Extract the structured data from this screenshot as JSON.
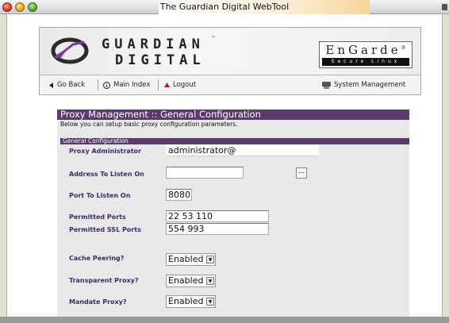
{
  "window": {
    "title": "The Guardian Digital WebTool"
  },
  "logo": {
    "word_top": "GUARDIAN",
    "word_bottom": "DIGITAL",
    "tm": "™",
    "engarde_name": "EnGarde",
    "engarde_tm": "®",
    "engarde_sub": "Secure Linux"
  },
  "nav": {
    "back": "Go Back",
    "main_index": "Main Index",
    "logout": "Logout",
    "system_management": "System Management",
    "icons": {
      "back": "triangle-left-icon",
      "main_index": "info-circle-icon",
      "logout": "triangle-up-icon",
      "system_management": "server-icon"
    }
  },
  "page": {
    "title": "Proxy Management :: General Configuration",
    "description": "Below you can setup basic proxy configuration parameters.",
    "subheader": "General Configuration"
  },
  "form": {
    "proxy_admin": {
      "label": "Proxy Administrator",
      "value": "administrator@"
    },
    "address": {
      "label": "Address To Listen On",
      "value": "",
      "browse": "..."
    },
    "port": {
      "label": "Port To Listen On",
      "value": "8080"
    },
    "permitted_ports": {
      "label": "Permitted Ports",
      "value": "22 53 110"
    },
    "permitted_ssl_ports": {
      "label": "Permitted SSL Ports",
      "value": "554 993"
    },
    "cache_peering": {
      "label": "Cache Peering?",
      "value": "Enabled"
    },
    "transparent_proxy": {
      "label": "Transparent Proxy?",
      "value": "Enabled"
    },
    "mandate_proxy": {
      "label": "Mandate Proxy?",
      "value": "Enabled"
    }
  },
  "colors": {
    "accent": "#5b3a6c",
    "label": "#3b2c66",
    "content_bg": "#e8e8e8"
  }
}
